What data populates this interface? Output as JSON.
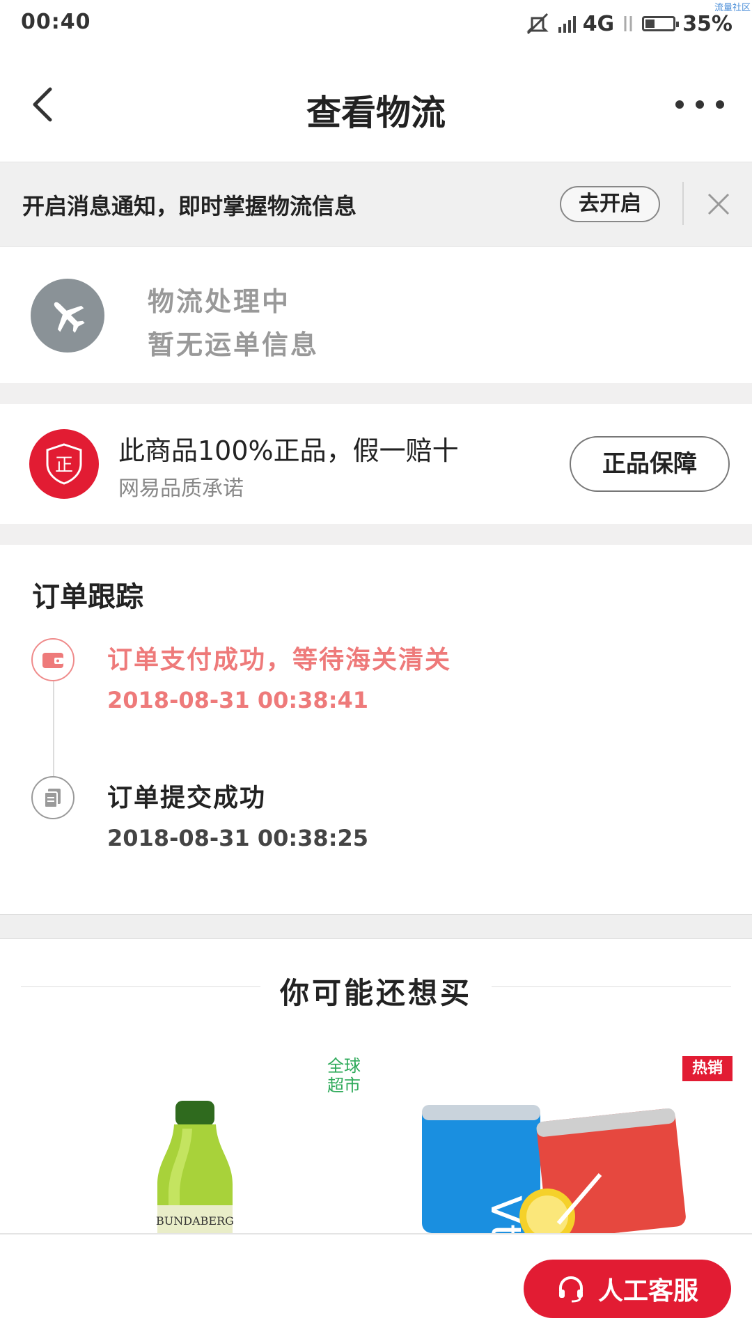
{
  "status_bar": {
    "time": "00:40",
    "network": "4G",
    "battery": "35%",
    "battery_level": 0.35,
    "watermark": "流量社区"
  },
  "nav": {
    "title": "查看物流",
    "back_icon": "chevron-left-icon",
    "more_icon": "more-dots-icon"
  },
  "notify": {
    "text": "开启消息通知，即时掌握物流信息",
    "button": "去开启",
    "close_icon": "close-icon"
  },
  "logistics": {
    "line1": "物流处理中",
    "line2": "暂无运单信息",
    "icon": "plane-icon"
  },
  "guarantee": {
    "icon_char": "正",
    "title": "此商品100%正品，假一赔十",
    "subtitle": "网易品质承诺",
    "button": "正品保障"
  },
  "tracking": {
    "title": "订单跟踪",
    "events": [
      {
        "title": "订单支付成功，等待海关清关",
        "time": "2018-08-31 00:38:41",
        "icon": "wallet-icon"
      },
      {
        "title": "订单提交成功",
        "time": "2018-08-31 00:38:25",
        "icon": "document-icon"
      }
    ]
  },
  "recommend": {
    "title": "你可能还想买",
    "global_tag": "全球\n超市",
    "hot_tag": "热销"
  },
  "customer_service": {
    "label": "人工客服",
    "icon": "headset-icon"
  },
  "colors": {
    "brand_red": "#e21c33",
    "timeline_red": "#ee7a7a"
  }
}
